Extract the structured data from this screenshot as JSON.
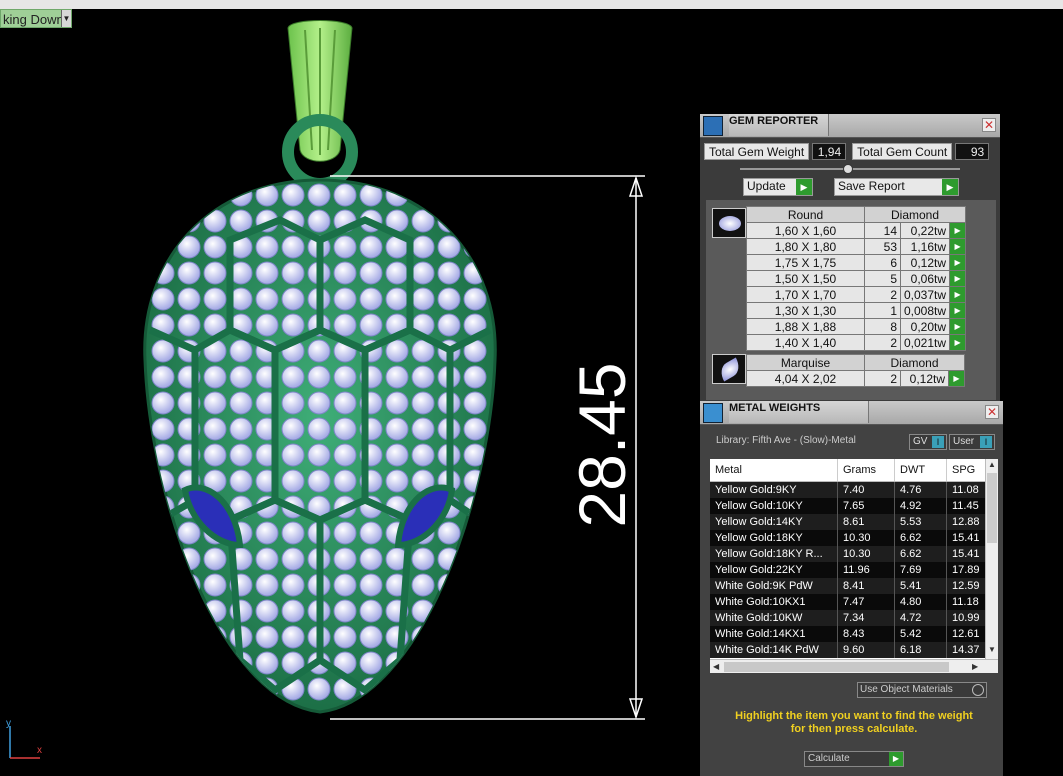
{
  "viewport": {
    "label": "king Down",
    "dropdown_icon": "triangle-down",
    "dimension_text": "28.45",
    "axis_x": "x",
    "axis_y": "y"
  },
  "gem_reporter": {
    "title": "GEM REPORTER",
    "total_weight_label": "Total Gem Weight",
    "total_weight": "1,94",
    "total_count_label": "Total Gem Count",
    "total_count": "93",
    "update_label": "Update",
    "save_label": "Save Report",
    "round": {
      "shape": "Round",
      "material": "Diamond",
      "rows": [
        {
          "size": "1,60 X 1,60",
          "count": "14",
          "weight": "0,22tw"
        },
        {
          "size": "1,80 X 1,80",
          "count": "53",
          "weight": "1,16tw"
        },
        {
          "size": "1,75 X 1,75",
          "count": "6",
          "weight": "0,12tw"
        },
        {
          "size": "1,50 X 1,50",
          "count": "5",
          "weight": "0,06tw"
        },
        {
          "size": "1,70 X 1,70",
          "count": "2",
          "weight": "0,037tw"
        },
        {
          "size": "1,30 X 1,30",
          "count": "1",
          "weight": "0,008tw"
        },
        {
          "size": "1,88 X 1,88",
          "count": "8",
          "weight": "0,20tw"
        },
        {
          "size": "1,40 X 1,40",
          "count": "2",
          "weight": "0,021tw"
        }
      ]
    },
    "marquise": {
      "shape": "Marquise",
      "material": "Diamond",
      "rows": [
        {
          "size": "4,04 X 2,02",
          "count": "2",
          "weight": "0,12tw"
        }
      ]
    }
  },
  "metal_weights": {
    "title": "METAL WEIGHTS",
    "library": "Library: Fifth Ave - (Slow)-Metal",
    "gv_label": "GV",
    "user_label": "User",
    "toggle_indicator": "I",
    "columns": [
      "Metal",
      "Grams",
      "DWT",
      "SPG"
    ],
    "rows": [
      {
        "metal": "Yellow Gold:9KY",
        "grams": "7.40",
        "dwt": "4.76",
        "spg": "11.08"
      },
      {
        "metal": "Yellow Gold:10KY",
        "grams": "7.65",
        "dwt": "4.92",
        "spg": "11.45"
      },
      {
        "metal": "Yellow Gold:14KY",
        "grams": "8.61",
        "dwt": "5.53",
        "spg": "12.88"
      },
      {
        "metal": "Yellow Gold:18KY",
        "grams": "10.30",
        "dwt": "6.62",
        "spg": "15.41"
      },
      {
        "metal": "Yellow Gold:18KY R...",
        "grams": "10.30",
        "dwt": "6.62",
        "spg": "15.41"
      },
      {
        "metal": "Yellow Gold:22KY",
        "grams": "11.96",
        "dwt": "7.69",
        "spg": "17.89"
      },
      {
        "metal": "White Gold:9K PdW",
        "grams": "8.41",
        "dwt": "5.41",
        "spg": "12.59"
      },
      {
        "metal": "White Gold:10KX1",
        "grams": "7.47",
        "dwt": "4.80",
        "spg": "11.18"
      },
      {
        "metal": "White Gold:10KW",
        "grams": "7.34",
        "dwt": "4.72",
        "spg": "10.99"
      },
      {
        "metal": "White Gold:14KX1",
        "grams": "8.43",
        "dwt": "5.42",
        "spg": "12.61"
      },
      {
        "metal": "White Gold:14K PdW",
        "grams": "9.60",
        "dwt": "6.18",
        "spg": "14.37"
      }
    ],
    "use_object_materials": "Use Object Materials",
    "hint_line1": "Highlight the item you want to find the weight",
    "hint_line2": "for then press calculate.",
    "calculate_label": "Calculate"
  },
  "colors": {
    "metal_green": "#2a8a5a",
    "bail_green": "#8ee070",
    "panel_gray": "#4a4a4a",
    "hint_yellow": "#f0d020",
    "go_green": "#2e9b2e"
  }
}
